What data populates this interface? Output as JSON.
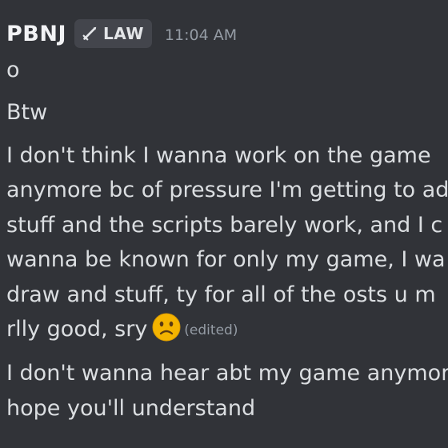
{
  "message": {
    "username": "PBNJ",
    "tag_icon": "sword-icon",
    "tag_label": "LAW",
    "timestamp": "11:04 AM",
    "lines": [
      "o",
      "Btw",
      "I don't think I wanna work on the game",
      "anymore bc of pressure I'm getting to ad",
      "stuff and the scripts barely work, and I c",
      "wanna be known for only my game, I wa",
      "draw and stuff, ty for all of the osts u m",
      "rlly good, sry",
      "I don't wanna hear abt my game anymor",
      "hope you'll understand"
    ],
    "emoji": "slightly-frowning-face-emoji",
    "edited_label": "(edited)"
  },
  "colors": {
    "background": "#313338",
    "username": "#f2f3f5",
    "text": "#dbdee1",
    "muted": "#949ba4",
    "tag_background": "#43454c",
    "emoji_face": "#f4b400"
  }
}
